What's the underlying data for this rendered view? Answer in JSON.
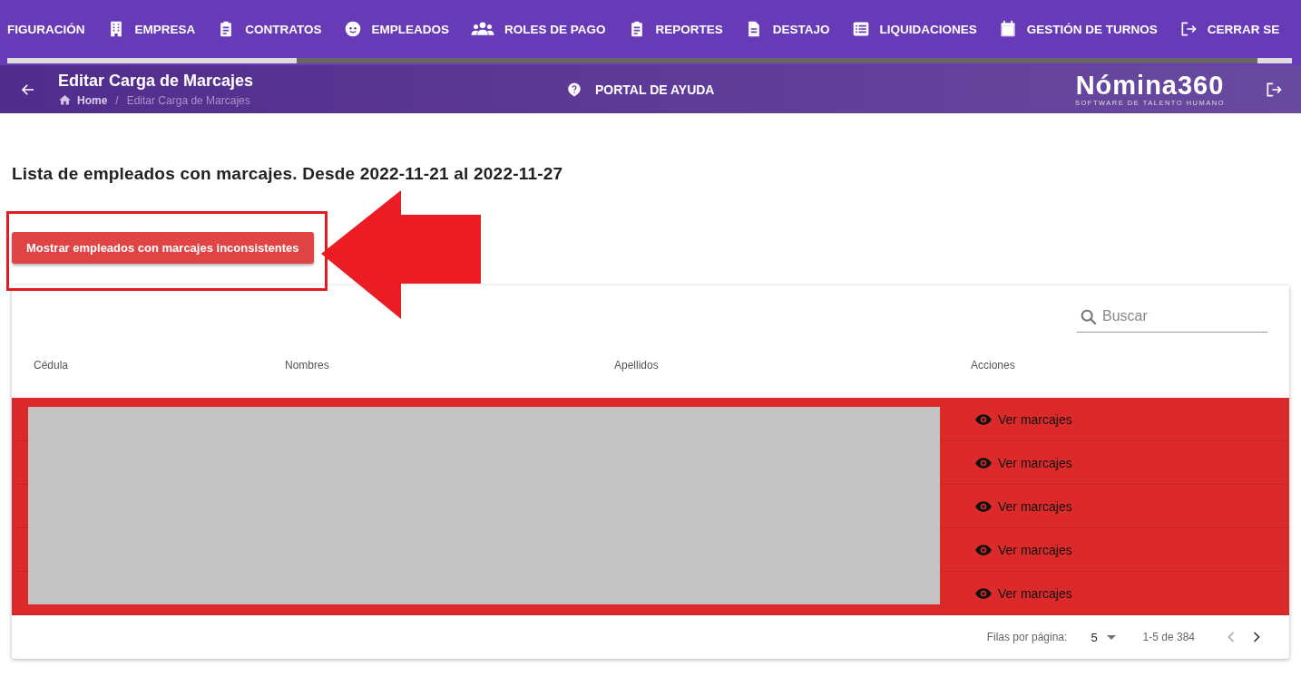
{
  "nav": {
    "items": [
      {
        "label": "FIGURACIÓN",
        "kind": "text"
      },
      {
        "label": "EMPRESA",
        "kind": "building"
      },
      {
        "label": "CONTRATOS",
        "kind": "clipboard"
      },
      {
        "label": "EMPLEADOS",
        "kind": "face"
      },
      {
        "label": "ROLES DE PAGO",
        "kind": "group"
      },
      {
        "label": "REPORTES",
        "kind": "clipboard"
      },
      {
        "label": "DESTAJO",
        "kind": "document"
      },
      {
        "label": "LIQUIDACIONES",
        "kind": "list"
      },
      {
        "label": "GESTIÓN DE TURNOS",
        "kind": "calendar"
      },
      {
        "label": "CERRAR SE",
        "kind": "logout"
      }
    ]
  },
  "header": {
    "title": "Editar Carga de Marcajes",
    "breadcrumb_separator": "/",
    "breadcrumbs": [
      {
        "label": "Home",
        "selected": false
      },
      {
        "label": "Editar Carga de Marcajes",
        "selected": true
      }
    ],
    "help": "PORTAL DE AYUDA",
    "logo": "Nómina360",
    "tagline": "SOFTWARE DE TALENTO HUMANO"
  },
  "page": {
    "heading": "Lista de empleados con marcajes. Desde 2022-11-21 al 2022-11-27",
    "filter_button": "Mostrar empleados con marcajes inconsistentes"
  },
  "table": {
    "search": {
      "placeholder": "Buscar"
    },
    "columns": [
      "Cédula",
      "Nombres",
      "Apellidos",
      "Acciones"
    ],
    "rows": [
      {
        "inconsistent": true,
        "action": "Ver marcajes"
      },
      {
        "inconsistent": true,
        "action": "Ver marcajes"
      },
      {
        "inconsistent": true,
        "action": "Ver marcajes"
      },
      {
        "inconsistent": true,
        "action": "Ver marcajes"
      },
      {
        "inconsistent": true,
        "action": "Ver marcajes"
      }
    ],
    "footer": {
      "rows_label": "Filas por página:",
      "rows_per_page": "5",
      "range": "1-5 de 384",
      "prev_disabled": true,
      "next_disabled": false
    }
  }
}
